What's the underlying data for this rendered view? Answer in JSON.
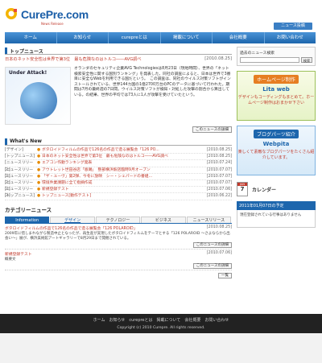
{
  "header": {
    "logo_text": "CurePre.com",
    "logo_sub": "News Release",
    "post_button": "ニュース投稿"
  },
  "nav": [
    "ホーム",
    "お知らせ",
    "curepreとは",
    "掲載について",
    "会社概要",
    "お問い合わせ"
  ],
  "top_news": {
    "heading": "トップニュース",
    "link": "日本のネット安全性は世界で第3位　最も危険なのはトルコ――AVG調べ",
    "date": "[2010.08.25]",
    "image_title": "Under Attack!",
    "body": "オランダのセキュリティ企業AVG Technologiesは8月23日（現地時間）、世界の「ネット検索安全性に関する国別ランキング」を発表した。同社の調査によると、日本は世界で3番目に安全なWebを利用できる国だという。　この調査は、同社のウイルス対策ソフトがインストールされている、世界144カ国の1億2700万台のPCのデータに基づいて行われた。期間は7月の最終週の7日間。ウイルス対策ソフトが検知・対処した攻撃の割合から算出している。の結果、世界の平均では73人に1人が攻撃を受けていたという。",
    "more": "このニュースの詳細"
  },
  "whats_new": {
    "heading": "What's New",
    "items": [
      {
        "cat": "[デザイン]",
        "title": "ボタロイドフィルムの作品で126名の作品で造る展覧会「126 PO...",
        "date": "[2010.08.25]"
      },
      {
        "cat": "[トップニュース]",
        "title": "日本のネット安全性は世界で第3位　最も危険なのはトルコ――AVG調べ",
        "date": "[2010.08.25]"
      },
      {
        "cat": "[ニュースリリース]",
        "title": "エアコン作動ランキング発表",
        "date": "[2010.07.24]"
      },
      {
        "cat": "[ニュースリリース]",
        "title": "アウトレット世田谷店「恩賜」　整部横浜駅店臨時9月オープン",
        "date": "[2010.07.07]"
      },
      {
        "cat": "[ニュースリリース]",
        "title": "「ザ・ユーヴ」第2弾、今冬に放映　シー・シェパードの番組...",
        "date": "[2010.07.07]"
      },
      {
        "cat": "[ニュースリリース]",
        "title": "環境件業課題に全て指摘作成",
        "date": "[2010.07.07]"
      },
      {
        "cat": "[ニュースリリース]",
        "title": "新規登録テスト",
        "date": "[2010.07.06]"
      },
      {
        "cat": "[トップニュース]",
        "title": "トップニュース[動作テスト]",
        "date": "[2010.06.22]"
      }
    ]
  },
  "categories": {
    "heading": "カテゴリーニュース",
    "tabs": [
      "Information",
      "デザイン",
      "テクノロジー",
      "ビジネス",
      "ニュースリリース"
    ],
    "items": [
      {
        "title": "ボタロイドフィルムの作品で126名の作品で造る展覧会「126 POLAROID」",
        "date": "[2010.08.25]",
        "body": "2009年に惜しまれながら製造中止となったが、再生産が実現したボタロイドフィルムをテーマとする「126 POLAROID ～さよならから出会い～」展が、横浜美術館アートギャラリーで8月29日まで開催されている。",
        "more": "このニュースの詳細"
      },
      {
        "title": "新規登録テスト",
        "date": "[2010.07.06]",
        "body": "概要文",
        "more": "このニュースの詳細"
      }
    ],
    "list_button": "一覧"
  },
  "sidebar": {
    "search_title": "過去のニュース検索",
    "search_button": "検索",
    "banner1": {
      "tag": "ホームページ制作",
      "title": "Lita web",
      "text": "デザインもコーディングもまとめて。ホームページ制作はおまかせ下さい"
    },
    "banner2": {
      "tag": "ブログパーツ紹介",
      "title": "Webpita",
      "text": "楽しくて素敵なブログパーツをたくさん紹介しています。"
    },
    "calendar_month": "JAN",
    "calendar_day": "7",
    "calendar_label": "カレンダー",
    "schedule_title": "2011年01月07日の予定",
    "schedule_text": "現在登録されている行事はありません"
  },
  "footer": {
    "links": "ホーム　お知らせ　curepreとは　掲載について　会社概要　お問い合わせ",
    "copyright": "Copyright (c) 2010 Curepre. All rights reserved."
  }
}
